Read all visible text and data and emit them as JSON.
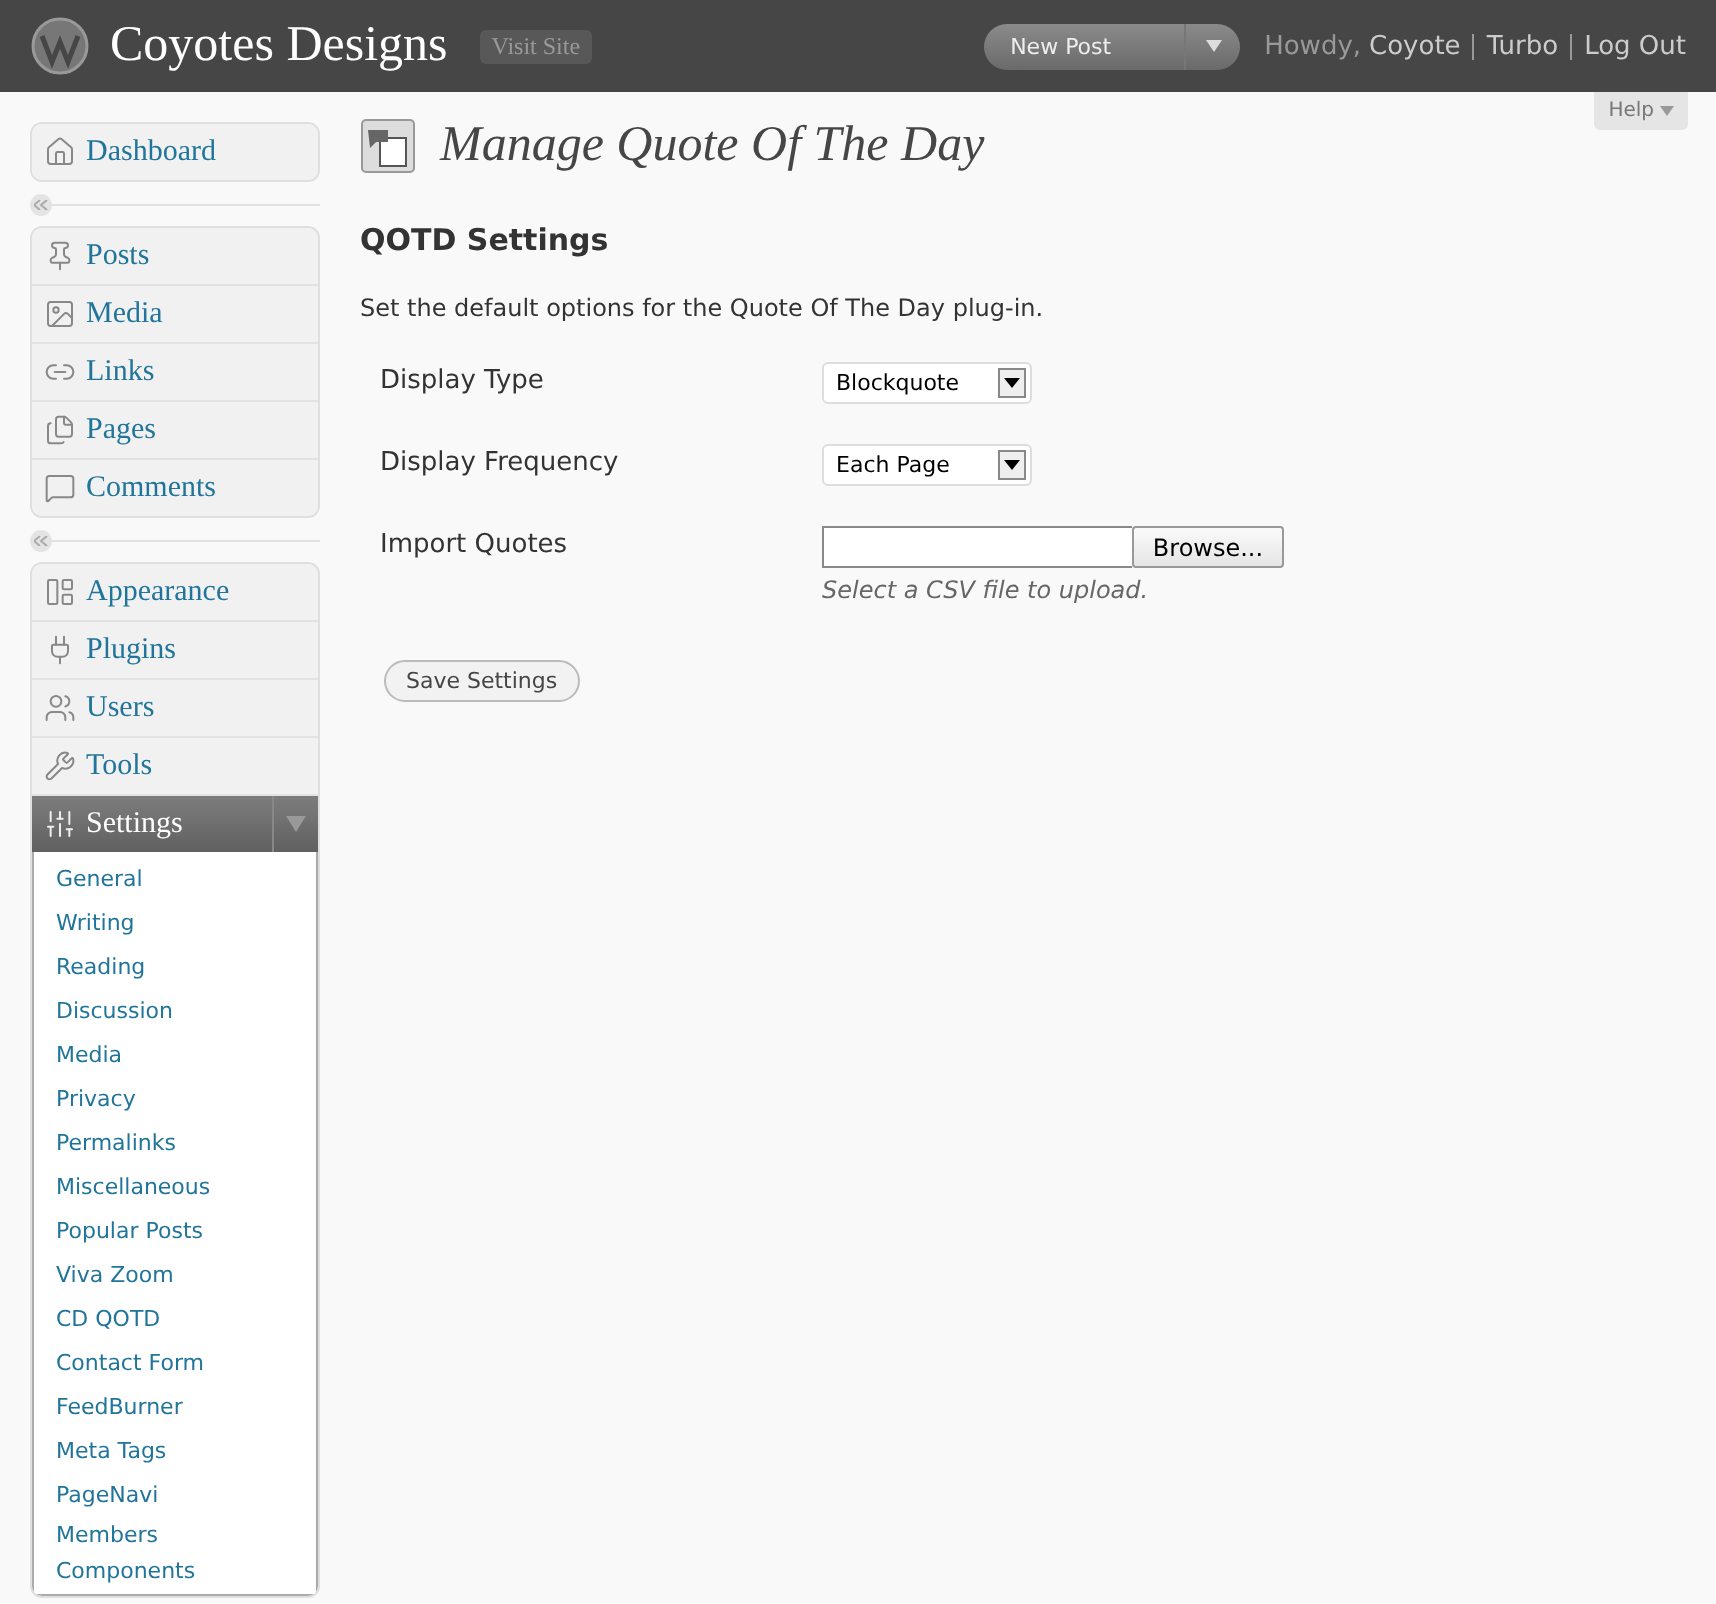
{
  "header": {
    "site_title": "Coyotes Designs",
    "visit_site": "Visit Site",
    "new_post": "New Post",
    "greeting": "Howdy,",
    "user": "Coyote",
    "links": [
      "Turbo",
      "Log Out"
    ]
  },
  "help": "Help",
  "sidebar": {
    "groups": [
      {
        "items": [
          {
            "label": "Dashboard",
            "selected": false
          }
        ]
      },
      {
        "items": [
          {
            "label": "Posts",
            "selected": false
          },
          {
            "label": "Media",
            "selected": false
          },
          {
            "label": "Links",
            "selected": false
          },
          {
            "label": "Pages",
            "selected": false
          },
          {
            "label": "Comments",
            "selected": false
          }
        ]
      },
      {
        "items": [
          {
            "label": "Appearance",
            "selected": false
          },
          {
            "label": "Plugins",
            "selected": false
          },
          {
            "label": "Users",
            "selected": false
          },
          {
            "label": "Tools",
            "selected": false
          },
          {
            "label": "Settings",
            "selected": true,
            "expanded": true,
            "children": [
              {
                "label": "General",
                "selected": false
              },
              {
                "label": "Writing",
                "selected": false
              },
              {
                "label": "Reading",
                "selected": false
              },
              {
                "label": "Discussion",
                "selected": false
              },
              {
                "label": "Media",
                "selected": false
              },
              {
                "label": "Privacy",
                "selected": false
              },
              {
                "label": "Permalinks",
                "selected": false
              },
              {
                "label": "Miscellaneous",
                "selected": false
              },
              {
                "label": "Popular Posts",
                "selected": false
              },
              {
                "label": "Viva Zoom",
                "selected": false
              },
              {
                "label": "CD QOTD",
                "selected": false
              },
              {
                "label": "Contact Form",
                "selected": false
              },
              {
                "label": "FeedBurner",
                "selected": false
              },
              {
                "label": "Meta Tags",
                "selected": false
              },
              {
                "label": "PageNavi",
                "selected": false
              },
              {
                "label": "Members Components",
                "selected": false
              }
            ]
          }
        ]
      }
    ]
  },
  "page": {
    "title": "Manage Quote Of The Day",
    "section_heading": "QOTD Settings",
    "description": "Set the default options for the Quote Of The Day plug-in.",
    "fields": [
      {
        "kind": "select",
        "label": "Display Type",
        "value": "Blockquote"
      },
      {
        "kind": "select",
        "label": "Display Frequency",
        "value": "Each Page"
      },
      {
        "kind": "file",
        "label": "Import Quotes",
        "button": "Browse...",
        "hint": "Select a CSV file to upload."
      }
    ],
    "save_button": "Save Settings"
  }
}
